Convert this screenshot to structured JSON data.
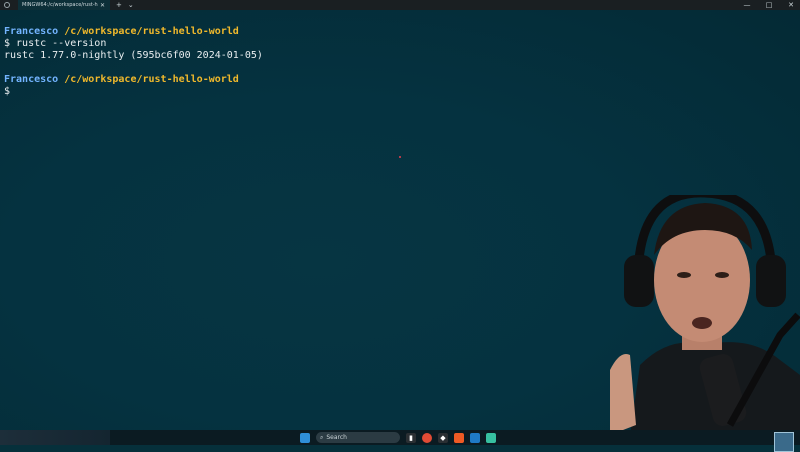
{
  "titlebar": {
    "tab_title": "MINGW64:/c/workspace/rust-he",
    "tab_close": "✕",
    "new_tab": "+",
    "dropdown": "⌄",
    "minimize": "—",
    "maximize": "□",
    "close": "✕"
  },
  "terminal": {
    "prompt1": {
      "user": "Francesco",
      "path": "/c/workspace/rust-hello-world"
    },
    "command1": "$ rustc --version",
    "output1": "rustc 1.77.0-nightly (595bc6f00 2024-01-05)",
    "prompt2": {
      "user": "Francesco",
      "path": "/c/workspace/rust-hello-world"
    },
    "cursor_line": "$"
  },
  "taskbar": {
    "search_placeholder": "Search",
    "icons": [
      "windows-start",
      "search",
      "terminal",
      "chrome",
      "git",
      "brave",
      "vscode",
      "app"
    ]
  },
  "colors": {
    "terminal_bg": "#06303b",
    "user": "#73b4ff",
    "path": "#f1b92c",
    "text": "#e9eef0"
  }
}
